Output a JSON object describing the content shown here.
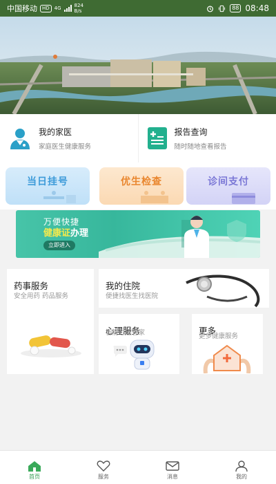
{
  "status_bar": {
    "carrier": "中国移动",
    "hd": "HD",
    "net": "4G",
    "speed_value": "824",
    "speed_unit": "B/s",
    "battery": "88",
    "time": "08:48"
  },
  "quick_links": [
    {
      "title": "我的家医",
      "subtitle": "家庭医生健康服务"
    },
    {
      "title": "报告查询",
      "subtitle": "随时随地查看报告"
    }
  ],
  "registration": [
    {
      "label": "当日挂号",
      "color": "#3d9bd9"
    },
    {
      "label": "优生检查",
      "color": "#e9862e"
    },
    {
      "label": "诊间支付",
      "color": "#7b78d6"
    }
  ],
  "promo": {
    "line1": "万便快捷",
    "line2_prefix": "",
    "line2_highlight": "健康证",
    "line2_suffix": "办理",
    "cta": "立即进入"
  },
  "services": {
    "pharmacy": {
      "title": "药事服务",
      "subtitle": "安全用药 药品服务"
    },
    "hospital": {
      "title": "我的住院",
      "subtitle": "便捷找医生找医院"
    },
    "psychology": {
      "title": "心理服务",
      "subtitle": "智能心理管家"
    },
    "more": {
      "title": "更多",
      "subtitle": "更多健康服务"
    }
  },
  "tabs": [
    {
      "label": "首页",
      "icon": "home-icon",
      "active": true
    },
    {
      "label": "服务",
      "icon": "heart-icon",
      "active": false
    },
    {
      "label": "消息",
      "icon": "mail-icon",
      "active": false
    },
    {
      "label": "我的",
      "icon": "user-icon",
      "active": false
    }
  ],
  "colors": {
    "accent": "#2e9b4e",
    "teal": "#3cb89c"
  }
}
